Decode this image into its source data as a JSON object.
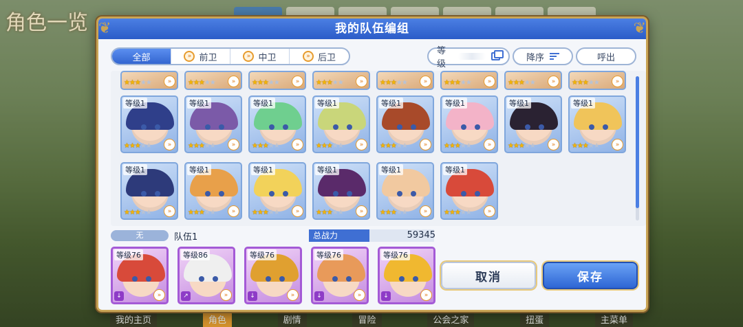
{
  "background": {
    "title": "角色一览",
    "bottom_nav": [
      "我的主页",
      "角色",
      "剧情",
      "冒险",
      "公会之家",
      "扭蛋",
      "主菜单"
    ],
    "bottom_nav_active": 1
  },
  "dialog": {
    "title": "我的队伍编组",
    "filters": {
      "tabs": [
        {
          "label": "全部",
          "active": true
        },
        {
          "label": "前卫",
          "active": false
        },
        {
          "label": "中卫",
          "active": false
        },
        {
          "label": "后卫",
          "active": false
        }
      ],
      "sort_field_label": "等级",
      "sort_order_label": "降序",
      "third_pill_label": "呼出"
    },
    "roster": {
      "partial_row": [
        {
          "stars": 3
        },
        {
          "stars": 3
        },
        {
          "stars": 3
        },
        {
          "stars": 3
        },
        {
          "stars": 3
        },
        {
          "stars": 3
        },
        {
          "stars": 3
        },
        {
          "stars": 3
        }
      ],
      "rows": [
        [
          {
            "level": "等级1",
            "stars": 3,
            "hair": "#2f3f8a"
          },
          {
            "level": "等级1",
            "stars": 3,
            "hair": "#7b5aa8"
          },
          {
            "level": "等级1",
            "stars": 3,
            "hair": "#6fcf8f"
          },
          {
            "level": "等级1",
            "stars": 3,
            "hair": "#c9d67a"
          },
          {
            "level": "等级1",
            "stars": 3,
            "hair": "#a84a2a"
          },
          {
            "level": "等级1",
            "stars": 3,
            "hair": "#f3b3c8"
          },
          {
            "level": "等级1",
            "stars": 3,
            "hair": "#2a2232"
          },
          {
            "level": "等级1",
            "stars": 3,
            "hair": "#f0c45a"
          }
        ],
        [
          {
            "level": "等级1",
            "stars": 3,
            "hair": "#2d3a7a"
          },
          {
            "level": "等级1",
            "stars": 3,
            "hair": "#e8a04a"
          },
          {
            "level": "等级1",
            "stars": 3,
            "hair": "#f2d25a"
          },
          {
            "level": "等级1",
            "stars": 3,
            "hair": "#5a2a6a"
          },
          {
            "level": "等级1",
            "stars": 3,
            "hair": "#f1c9a0"
          },
          {
            "level": "等级1",
            "stars": 3,
            "hair": "#d84a3a"
          }
        ]
      ]
    },
    "team": {
      "tag": "无",
      "name": "队伍1",
      "power_label": "总战力",
      "power_value": "59345",
      "members": [
        {
          "level": "等级76",
          "hair": "#d84a3a",
          "rank": "↓"
        },
        {
          "level": "等级86",
          "hair": "#efefef",
          "rank": "↗"
        },
        {
          "level": "等级76",
          "hair": "#e0a030",
          "rank": "↓"
        },
        {
          "level": "等级76",
          "hair": "#e89a5a",
          "rank": "↓"
        },
        {
          "level": "等级76",
          "hair": "#f0b830",
          "rank": "↓"
        }
      ]
    },
    "buttons": {
      "cancel": "取消",
      "save": "保存"
    }
  }
}
